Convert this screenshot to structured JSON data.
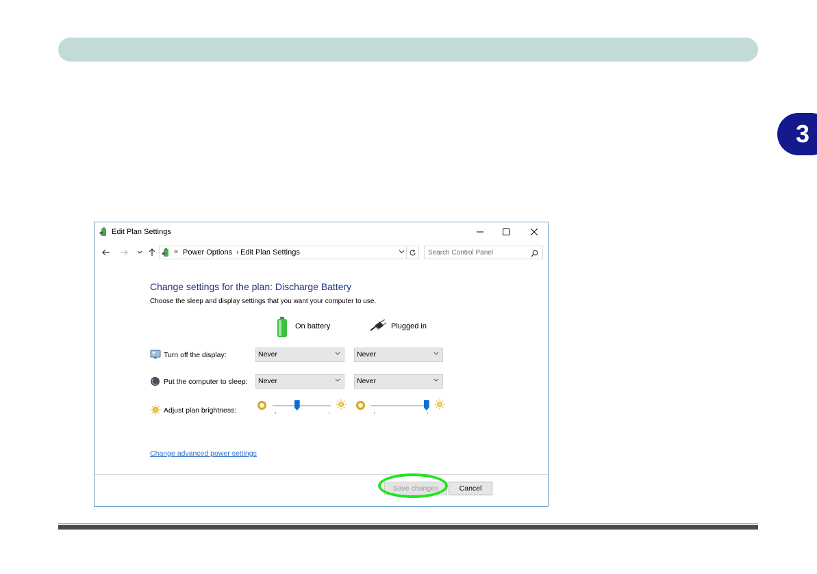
{
  "chapter": {
    "number": "3"
  },
  "window": {
    "title": "Edit Plan Settings",
    "controls": {
      "minimize": "—",
      "maximize": "☐",
      "close": "✕"
    }
  },
  "address_bar": {
    "breadcrumbs": [
      "Power Options",
      "Edit Plan Settings"
    ],
    "overflow_glyph": "«",
    "separator_glyph": "›",
    "search_placeholder": "Search Control Panel"
  },
  "content": {
    "heading": "Change settings for the plan: Discharge Battery",
    "description": "Choose the sleep and display settings that you want your computer to use.",
    "columns": {
      "on_battery": "On battery",
      "plugged_in": "Plugged in"
    },
    "rows": [
      {
        "label": "Turn off the display:",
        "on_battery": "Never",
        "plugged_in": "Never"
      },
      {
        "label": "Put the computer to sleep:",
        "on_battery": "Never",
        "plugged_in": "Never"
      }
    ],
    "brightness": {
      "label": "Adjust plan brightness:",
      "on_battery_level": 0.42,
      "plugged_in_level": 0.95
    },
    "advanced_link": "Change advanced power settings"
  },
  "buttons": {
    "save": "Save changes",
    "cancel": "Cancel"
  },
  "colors": {
    "accent_blue": "#1e3287",
    "link_blue": "#2b6cc4",
    "slider_thumb": "#0d6fd3",
    "highlight_green": "#1ee61e",
    "banner": "#c3dbd7",
    "chapter_tab": "#14198d"
  }
}
